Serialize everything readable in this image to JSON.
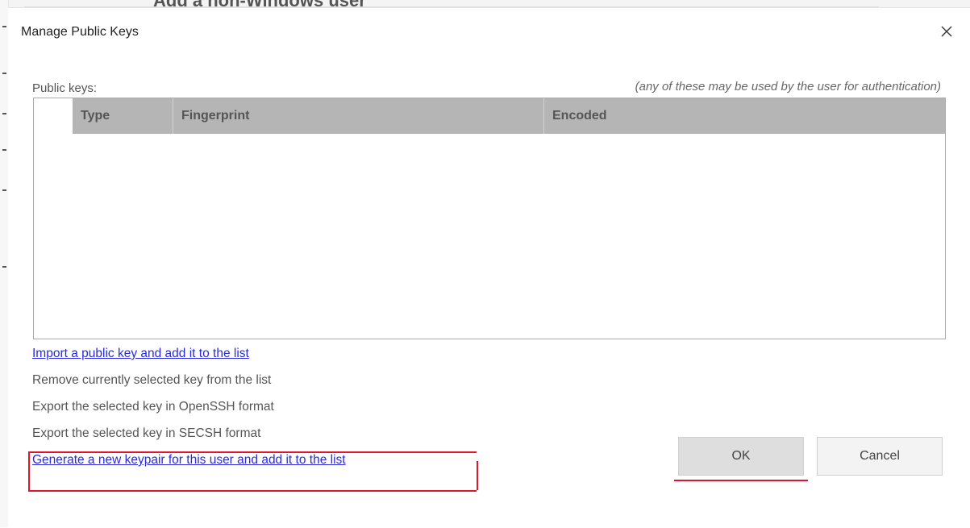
{
  "background_window": {
    "title": "Add a non-Windows user"
  },
  "dialog": {
    "title": "Manage Public Keys",
    "close_icon": "close-icon"
  },
  "keys": {
    "label": "Public keys:",
    "hint": "(any of these may be used by the user for authentication)",
    "columns": [
      "Type",
      "Fingerprint",
      "Encoded"
    ],
    "rows": []
  },
  "actions": [
    {
      "label": "Import a public key and add it to the list",
      "enabled": true
    },
    {
      "label": "Remove currently selected key from the list",
      "enabled": false
    },
    {
      "label": "Export the selected key in OpenSSH format",
      "enabled": false
    },
    {
      "label": "Export the selected key in SECSH format",
      "enabled": false
    },
    {
      "label": "Generate a new keypair for this user and add it to the list",
      "enabled": true
    }
  ],
  "buttons": {
    "ok": "OK",
    "cancel": "Cancel"
  },
  "colors": {
    "annotation": "#e0142a",
    "link": "#2a2adb",
    "header_bg": "#b5b5b5"
  }
}
